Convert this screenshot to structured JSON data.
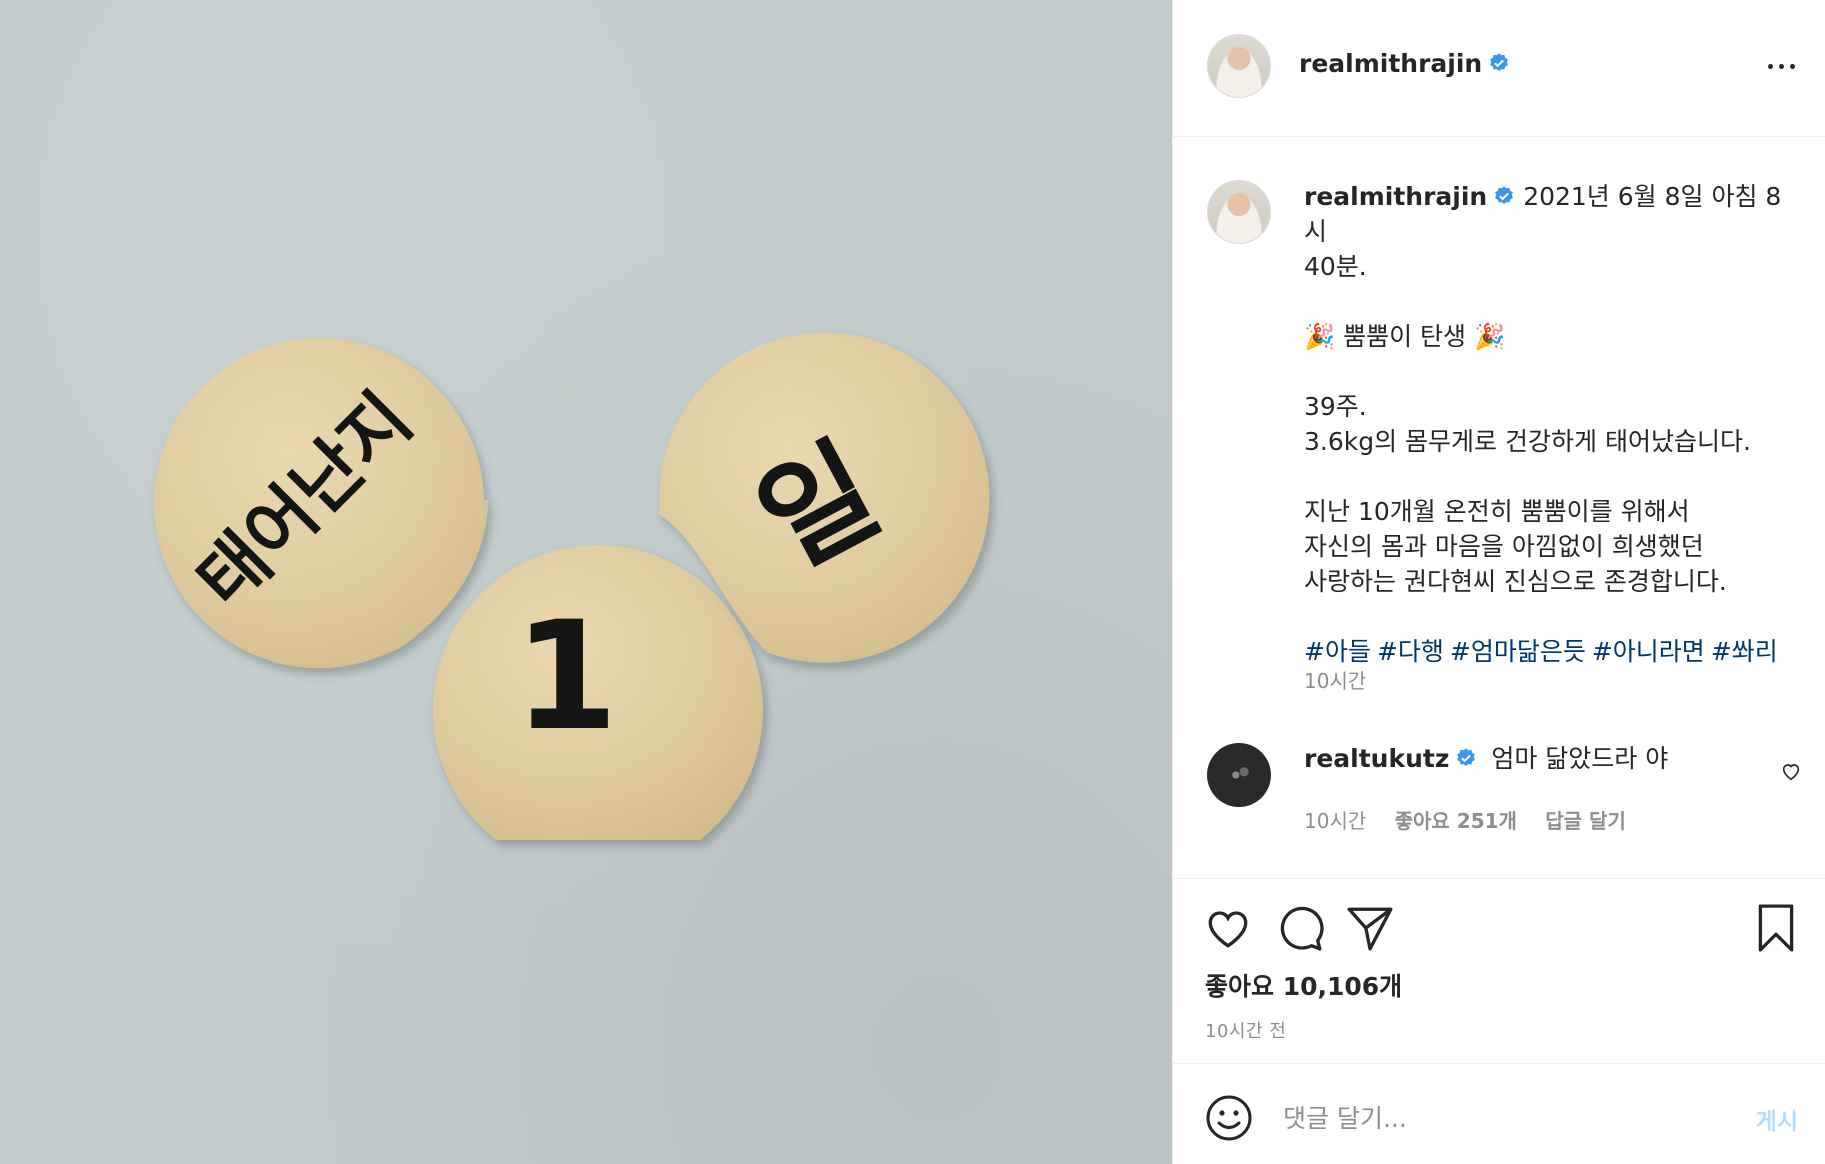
{
  "photo": {
    "disc_left_text": "태어난지",
    "disc_center_text": "1",
    "disc_right_text": "일"
  },
  "header": {
    "username": "realmithrajin",
    "verified_icon": "verified-badge-icon",
    "more_icon": "more-options-icon"
  },
  "caption": {
    "username": "realmithrajin",
    "lines": [
      "2021년 6월 8일 아침 8시",
      "40분."
    ],
    "birth_line": "🎉 뿜뿜이 탄생 🎉",
    "weeks": "39주.",
    "weight_line": "3.6kg의 몸무게로 건강하게 태어났습니다.",
    "thanks_lines": [
      "지난 10개월 온전히 뿜뿜이를 위해서",
      "자신의 몸과 마음을 아낌없이 희생했던",
      "사랑하는 권다현씨 진심으로 존경합니다."
    ],
    "hashtags": [
      "#아들",
      "#다행",
      "#엄마닮은듯",
      "#아니라면",
      "#쏴리"
    ],
    "time": "10시간"
  },
  "comment": {
    "username": "realtukutz",
    "text": "엄마 닮았드라 야",
    "time": "10시간",
    "likes": "좋아요 251개",
    "reply": "답글 달기"
  },
  "actions": {
    "likes": "좋아요 10,106개",
    "posted": "10시간 전"
  },
  "comment_box": {
    "placeholder": "댓글 달기...",
    "post_label": "게시"
  },
  "colors": {
    "verified": "#3897f0",
    "link": "#00376b",
    "muted": "#8e8e8e",
    "post_button": "#b2dffc",
    "photo_bg": "#c4cdce",
    "wood": "#e3cfa4"
  }
}
